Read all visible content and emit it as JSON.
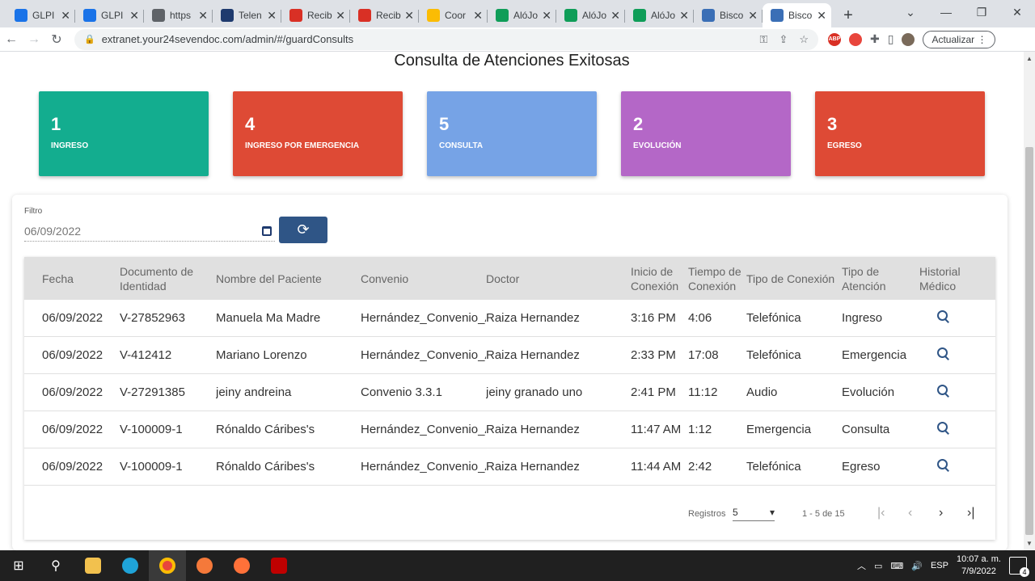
{
  "browser": {
    "tabs": [
      {
        "label": "GLPI",
        "icon": "glpi-icon",
        "color": "#1a73e8"
      },
      {
        "label": "GLPI",
        "icon": "glpi-icon",
        "color": "#1a73e8"
      },
      {
        "label": "https",
        "icon": "globe-icon",
        "color": "#5f6368"
      },
      {
        "label": "Telen",
        "icon": "telemedicine-icon",
        "color": "#1e3a6e"
      },
      {
        "label": "Recib",
        "icon": "gmail-icon",
        "color": "#d93025"
      },
      {
        "label": "Recib",
        "icon": "gmail-icon",
        "color": "#d93025"
      },
      {
        "label": "Coor",
        "icon": "drive-icon",
        "color": "#fbbc04"
      },
      {
        "label": "AlóJo",
        "icon": "sheets-icon",
        "color": "#0f9d58"
      },
      {
        "label": "AlóJo",
        "icon": "sheets-icon",
        "color": "#0f9d58"
      },
      {
        "label": "AlóJo",
        "icon": "sheets-icon",
        "color": "#0f9d58"
      },
      {
        "label": "Bisco",
        "icon": "app-icon",
        "color": "#3b6fb6"
      },
      {
        "label": "Bisco",
        "icon": "app-icon",
        "color": "#3b6fb6"
      }
    ],
    "active_tab": 11,
    "url": "extranet.your24sevendoc.com/admin/#/guardConsults",
    "update_label": "Actualizar",
    "ext_abp": "ABP"
  },
  "page": {
    "title": "Consulta de Atenciones Exitosas",
    "cards": [
      {
        "count": "1",
        "label": "INGRESO",
        "color": "#13ad8f"
      },
      {
        "count": "4",
        "label": "INGRESO POR EMERGENCIA",
        "color": "#de4a35"
      },
      {
        "count": "5",
        "label": "CONSULTA",
        "color": "#76a3e6"
      },
      {
        "count": "2",
        "label": "EVOLUCIÓN",
        "color": "#b467c7"
      },
      {
        "count": "3",
        "label": "EGRESO",
        "color": "#de4a35"
      }
    ],
    "filter": {
      "label": "Filtro",
      "value": "06/09/2022"
    },
    "table": {
      "headers": [
        "Fecha",
        "Documento de Identidad",
        "Nombre del Paciente",
        "Convenio",
        "Doctor",
        "Inicio de Conexión",
        "Tiempo de Conexión",
        "Tipo de Conexión",
        "Tipo de Atención",
        "Historial Médico"
      ],
      "rows": [
        {
          "fecha": "06/09/2022",
          "documento": "V-27852963",
          "paciente": "Manuela Ma Madre",
          "convenio": "Hernández_Convenio_A",
          "doctor": "Raiza Hernandez",
          "inicio": "3:16 PM",
          "tiempo": "4:06",
          "tipo_conexion": "Telefónica",
          "tipo_atencion": "Ingreso"
        },
        {
          "fecha": "06/09/2022",
          "documento": "V-412412",
          "paciente": "Mariano Lorenzo",
          "convenio": "Hernández_Convenio_A",
          "doctor": "Raiza Hernandez",
          "inicio": "2:33 PM",
          "tiempo": "17:08",
          "tipo_conexion": "Telefónica",
          "tipo_atencion": "Emergencia"
        },
        {
          "fecha": "06/09/2022",
          "documento": "V-27291385",
          "paciente": "jeiny andreina",
          "convenio": "Convenio 3.3.1",
          "doctor": "jeiny granado uno",
          "inicio": "2:41 PM",
          "tiempo": "11:12",
          "tipo_conexion": "Audio",
          "tipo_atencion": "Evolución"
        },
        {
          "fecha": "06/09/2022",
          "documento": "V-100009-1",
          "paciente": "Rónaldo Cáribes's",
          "convenio": "Hernández_Convenio_A",
          "doctor": "Raiza Hernandez",
          "inicio": "11:47 AM",
          "tiempo": "1:12",
          "tipo_conexion": "Emergencia",
          "tipo_atencion": "Consulta"
        },
        {
          "fecha": "06/09/2022",
          "documento": "V-100009-1",
          "paciente": "Rónaldo Cáribes's",
          "convenio": "Hernández_Convenio_A",
          "doctor": "Raiza Hernandez",
          "inicio": "11:44 AM",
          "tiempo": "2:42",
          "tipo_conexion": "Telefónica",
          "tipo_atencion": "Egreso"
        }
      ]
    },
    "pager": {
      "registros_label": "Registros",
      "registros_value": "5",
      "range": "1 - 5 de 15"
    }
  },
  "taskbar": {
    "lang": "ESP",
    "time": "10:07 a. m.",
    "date": "7/9/2022",
    "notifications": "4"
  }
}
